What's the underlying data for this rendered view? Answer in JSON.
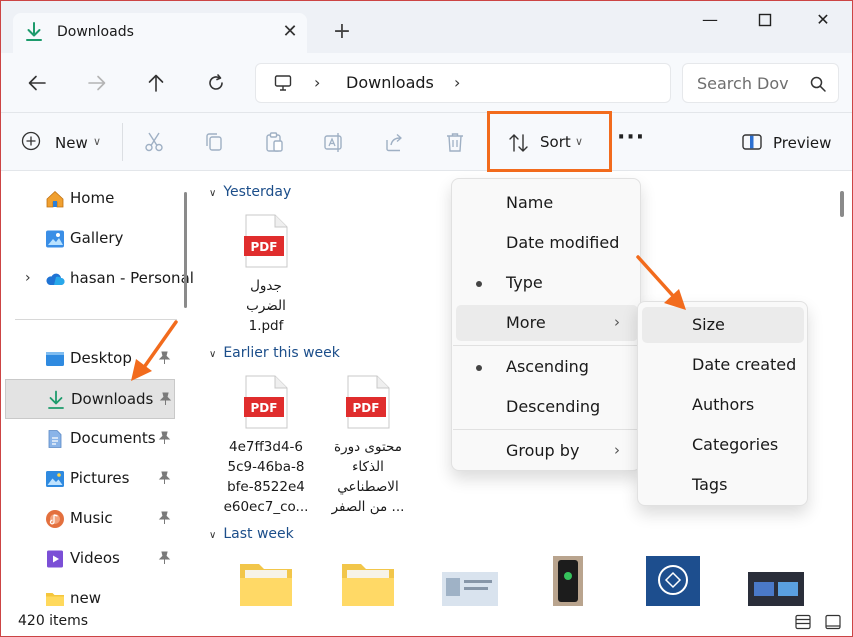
{
  "window": {
    "tab_title": "Downloads",
    "tab_icon": "download-icon",
    "controls": [
      "minimize-icon",
      "maximize-icon",
      "close-icon"
    ]
  },
  "nav": {
    "buttons": [
      "back-icon",
      "forward-icon",
      "up-icon",
      "refresh-icon"
    ],
    "address_location": "Downloads",
    "search_placeholder": "Search Dov"
  },
  "toolbar": {
    "new_label": "New",
    "sort_label": "Sort",
    "preview_label": "Preview",
    "icons": [
      "cut-icon",
      "copy-icon",
      "paste-icon",
      "rename-icon",
      "share-icon",
      "delete-icon"
    ],
    "highlight_color": "#f26b1d"
  },
  "sidebar": {
    "items": [
      {
        "label": "Home",
        "icon": "home-icon"
      },
      {
        "label": "Gallery",
        "icon": "gallery-icon"
      },
      {
        "label": "hasan - Personal",
        "icon": "onedrive-icon"
      },
      {
        "label": "Desktop",
        "icon": "desktop-icon",
        "pinned": true
      },
      {
        "label": "Downloads",
        "icon": "download-icon",
        "pinned": true,
        "selected": true
      },
      {
        "label": "Documents",
        "icon": "documents-icon",
        "pinned": true
      },
      {
        "label": "Pictures",
        "icon": "pictures-icon",
        "pinned": true
      },
      {
        "label": "Music",
        "icon": "music-icon",
        "pinned": true
      },
      {
        "label": "Videos",
        "icon": "videos-icon",
        "pinned": true
      },
      {
        "label": "new",
        "icon": "folder-icon"
      }
    ]
  },
  "content": {
    "groups": [
      {
        "title": "Yesterday",
        "files": [
          {
            "name": "جدول الضرب 1.pdf",
            "lines": [
              "جدول",
              "الضرب",
              "1.pdf"
            ],
            "type": "PDF"
          }
        ]
      },
      {
        "title": "Earlier this week",
        "files": [
          {
            "name": "4e7ff3d4-65c9-46ba-8bfe-8522e4e60ec7_co...",
            "lines": [
              "4e7ff3d4-6",
              "5c9-46ba-8",
              "bfe-8522e4",
              "e60ec7_co..."
            ],
            "type": "PDF"
          },
          {
            "name": "محتوى دورة الذكاء الاصطناعي من الصفر ...",
            "lines": [
              "محتوى دورة",
              "الذكاء",
              "الاصطناعي",
              "من الصفر ..."
            ],
            "type": "PDF"
          }
        ]
      },
      {
        "title": "Last week",
        "files": []
      }
    ]
  },
  "sort_menu": {
    "items": [
      "Name",
      "Date modified",
      "Type",
      "More",
      "Ascending",
      "Descending",
      "Group by"
    ],
    "checked": [
      "Type",
      "Ascending"
    ],
    "hovered": "More"
  },
  "more_submenu": {
    "items": [
      "Size",
      "Date created",
      "Authors",
      "Categories",
      "Tags"
    ],
    "hovered": "Size"
  },
  "status": {
    "item_count": "420 items"
  },
  "annotation_color": "#f26b1d"
}
